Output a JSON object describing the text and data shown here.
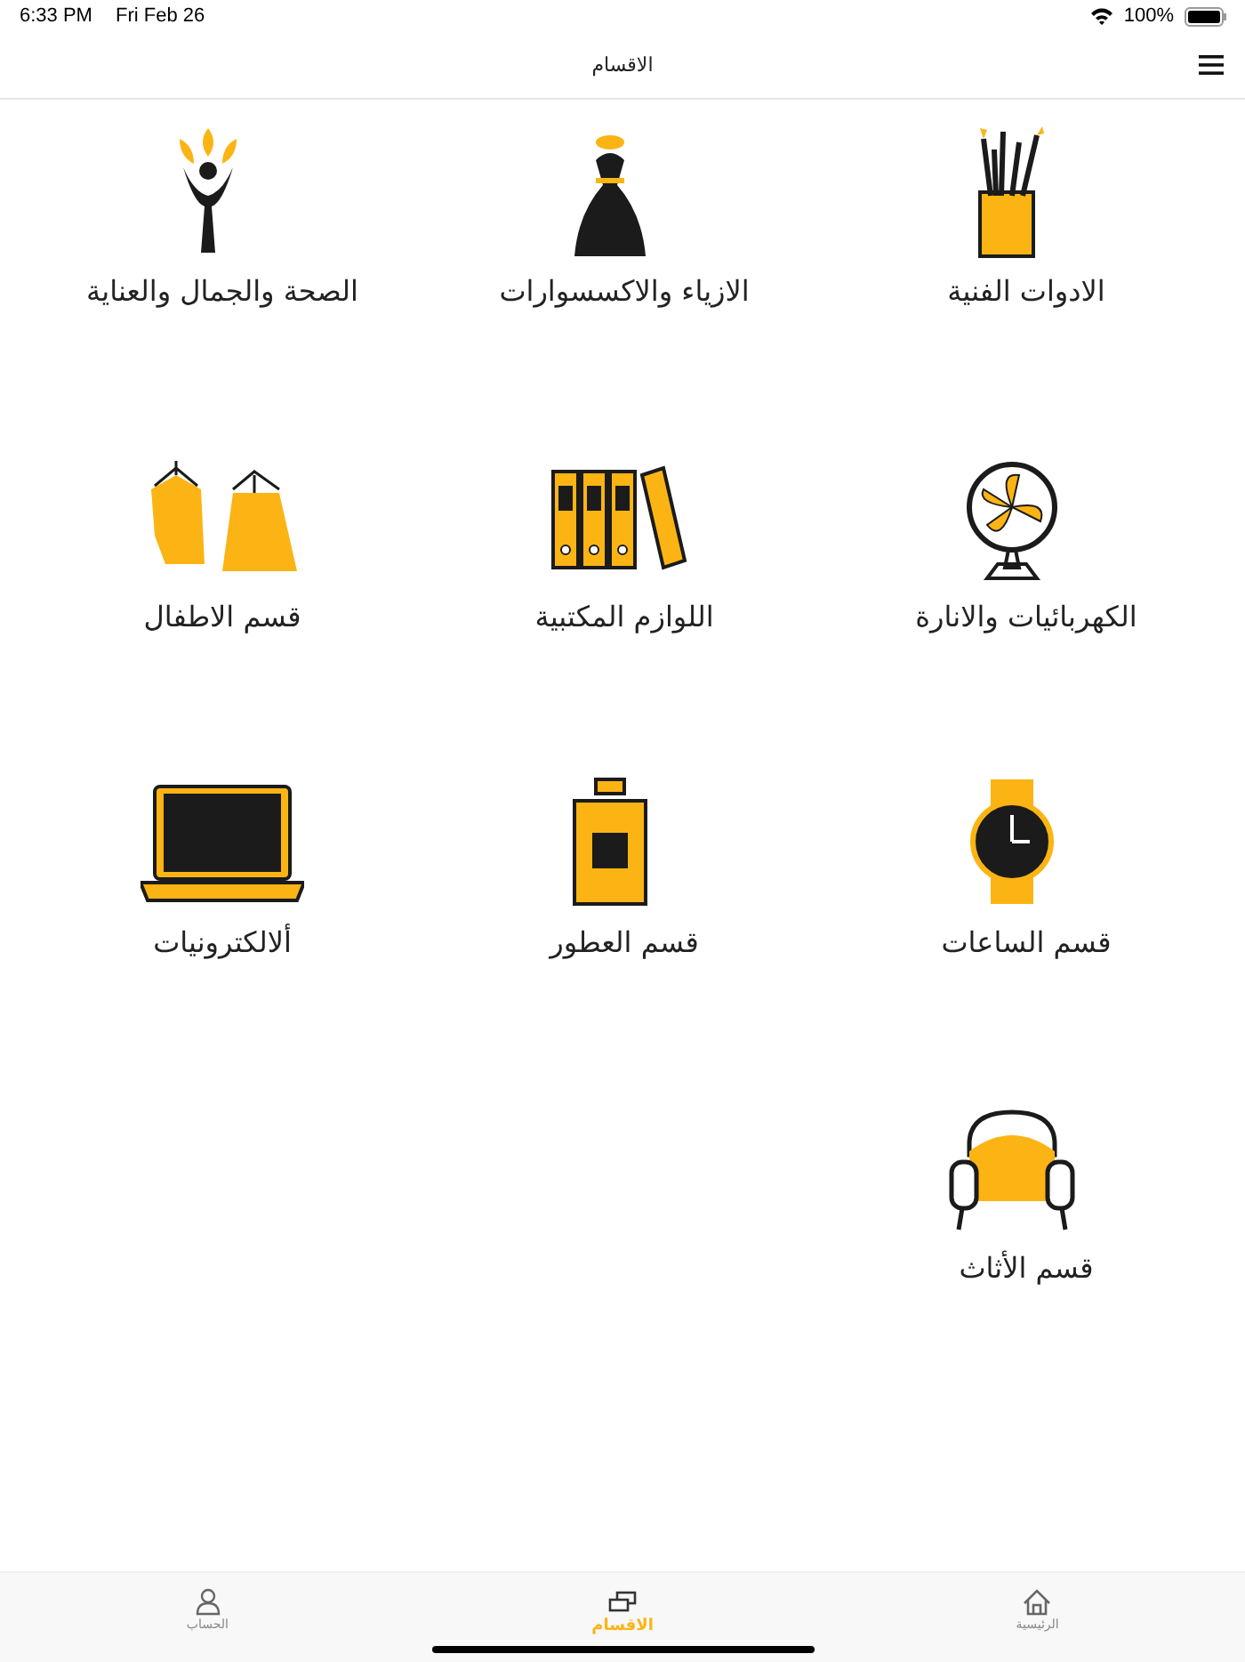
{
  "status_bar": {
    "time": "6:33 PM",
    "date": "Fri Feb 26",
    "battery": "100%"
  },
  "nav": {
    "title": "الاقسام"
  },
  "categories": [
    {
      "kind": "art",
      "label": "الادوات الفنية"
    },
    {
      "kind": "fashion",
      "label": "الازياء والاكسسوارات"
    },
    {
      "kind": "beauty",
      "label": "الصحة والجمال والعناية"
    },
    {
      "kind": "electric",
      "label": "الكهربائيات والانارة"
    },
    {
      "kind": "office",
      "label": "اللوازم المكتبية"
    },
    {
      "kind": "kids",
      "label": "قسم الاطفال"
    },
    {
      "kind": "watch",
      "label": "قسم الساعات"
    },
    {
      "kind": "perfume",
      "label": "قسم العطور"
    },
    {
      "kind": "laptop",
      "label": "ألالكترونيات"
    },
    {
      "kind": "furniture",
      "label": "قسم الأثاث"
    }
  ],
  "tab_bar": [
    {
      "kind": "home",
      "label": "الرئيسية",
      "selected": false
    },
    {
      "kind": "categories",
      "label": "الاقسام",
      "selected": true
    },
    {
      "kind": "account",
      "label": "الحساب",
      "selected": false
    }
  ]
}
